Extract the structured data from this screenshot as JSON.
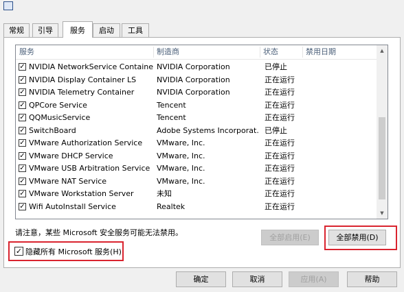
{
  "tabs": [
    "常规",
    "引导",
    "服务",
    "启动",
    "工具"
  ],
  "columns": [
    "服务",
    "制造商",
    "状态",
    "禁用日期"
  ],
  "services": [
    {
      "name": "NVIDIA NetworkService Container",
      "vendor": "NVIDIA Corporation",
      "status": "已停止",
      "checked": true
    },
    {
      "name": "NVIDIA Display Container LS",
      "vendor": "NVIDIA Corporation",
      "status": "正在运行",
      "checked": true
    },
    {
      "name": "NVIDIA Telemetry Container",
      "vendor": "NVIDIA Corporation",
      "status": "正在运行",
      "checked": true
    },
    {
      "name": "QPCore Service",
      "vendor": "Tencent",
      "status": "正在运行",
      "checked": true
    },
    {
      "name": "QQMusicService",
      "vendor": "Tencent",
      "status": "正在运行",
      "checked": true
    },
    {
      "name": "SwitchBoard",
      "vendor": "Adobe Systems Incorporat...",
      "status": "已停止",
      "checked": true
    },
    {
      "name": "VMware Authorization Service",
      "vendor": "VMware, Inc.",
      "status": "正在运行",
      "checked": true
    },
    {
      "name": "VMware DHCP Service",
      "vendor": "VMware, Inc.",
      "status": "正在运行",
      "checked": true
    },
    {
      "name": "VMware USB Arbitration Service",
      "vendor": "VMware, Inc.",
      "status": "正在运行",
      "checked": true
    },
    {
      "name": "VMware NAT Service",
      "vendor": "VMware, Inc.",
      "status": "正在运行",
      "checked": true
    },
    {
      "name": "VMware Workstation Server",
      "vendor": "未知",
      "status": "正在运行",
      "checked": true
    },
    {
      "name": "Wifi AutoInstall Service",
      "vendor": "Realtek",
      "status": "正在运行",
      "checked": true
    }
  ],
  "note": "请注意，某些 Microsoft 安全服务可能无法禁用。",
  "enable_all": "全部启用(E)",
  "disable_all": "全部禁用(D)",
  "hide_ms": "隐藏所有 Microsoft 服务(H)",
  "hide_ms_checked": true,
  "ok": "确定",
  "cancel": "取消",
  "apply": "应用(A)",
  "help": "帮助",
  "highlight_color": "#d9232e"
}
